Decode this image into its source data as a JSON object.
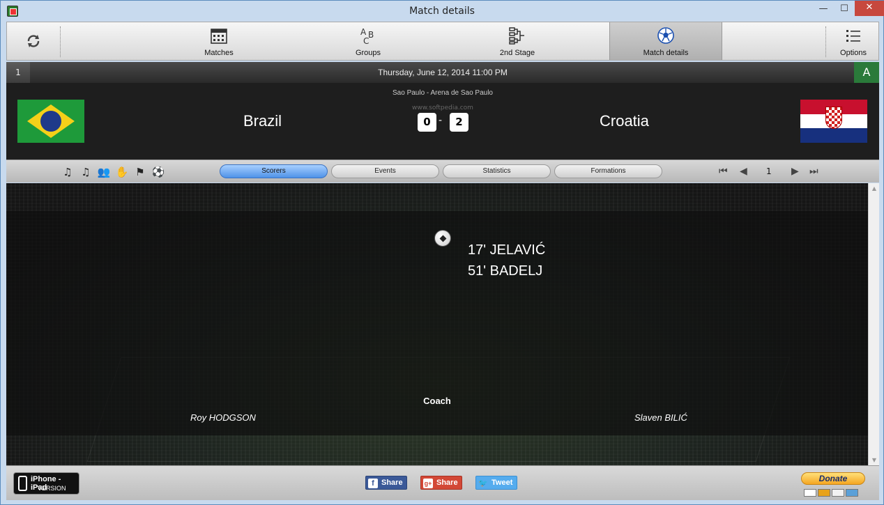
{
  "window": {
    "title": "Match details",
    "close_glyph": "✕",
    "min_glyph": "—",
    "max_glyph": "☐"
  },
  "toolbar": {
    "items": [
      {
        "label": "Matches",
        "icon": "calendar-icon"
      },
      {
        "label": "Groups",
        "icon": "abc-icon"
      },
      {
        "label": "2nd Stage",
        "icon": "bracket-icon"
      },
      {
        "label": "Match details",
        "icon": "soccer-ball-icon"
      },
      {
        "label": "Options",
        "icon": "list-icon"
      }
    ],
    "refresh_icon": "refresh-icon"
  },
  "match": {
    "number": "1",
    "datetime": "Thursday, June 12, 2014 11:00 PM",
    "group": "A",
    "venue": "Sao Paulo   -   Arena de Sao Paulo",
    "watermark": "www.softpedia.com",
    "home_team": "Brazil",
    "away_team": "Croatia",
    "home_score": "0",
    "away_score": "2",
    "score_separator": "-"
  },
  "tabs": {
    "items": [
      "Scorers",
      "Events",
      "Statistics",
      "Formations"
    ],
    "active": "Scorers"
  },
  "pager": {
    "page": "1",
    "first": "⏮",
    "prev": "◀",
    "next": "▶",
    "last": "⏭"
  },
  "scorers": {
    "away": [
      "17' JELAVIĆ",
      "51' BADELJ"
    ]
  },
  "coaches": {
    "title": "Coach",
    "home": "Roy HODGSON",
    "away": "Slaven BILIĆ"
  },
  "footer": {
    "iphone_line1": "iPhone - iPad",
    "iphone_line2": "VERSION",
    "share_facebook": "Share",
    "share_google": "Share",
    "share_twitter": "Tweet",
    "donate": "Donate"
  },
  "colors": {
    "accent_active_tab": "#4f92e8",
    "group_badge": "#2a7a3a",
    "facebook": "#3b5998",
    "google": "#d34836",
    "twitter": "#55acee"
  }
}
